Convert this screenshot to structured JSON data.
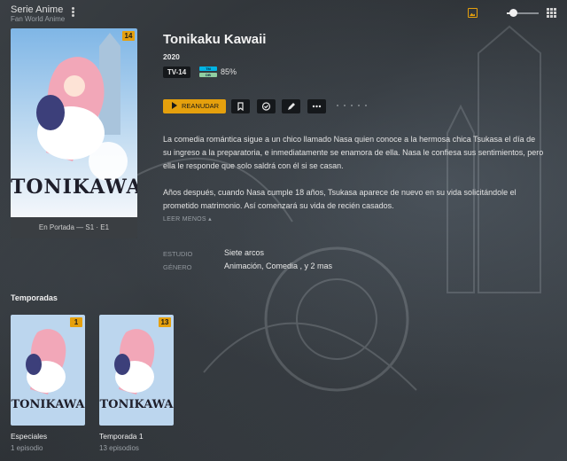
{
  "header": {
    "title": "Serie Anime",
    "subtitle": "Fan World Anime"
  },
  "colors": {
    "accent": "#e5a00d",
    "background": "#2f3336"
  },
  "icons": {
    "menu": "kebab-icon",
    "backdrop_toggle": "image-icon",
    "view_grid": "grid-icon"
  },
  "zoom_slider": {
    "level": 0.2
  },
  "show": {
    "poster_badge": "14",
    "poster_logo": "TONIKAWA",
    "on_deck_caption": "En Portada — S1 · E1",
    "title": "Tonikaku Kawaii",
    "year": "2020",
    "content_rating": "TV-14",
    "tmdb_top": "TM",
    "tmdb_bottom": "DB",
    "score": "85%",
    "play_label": "REANUDAR",
    "summary_1": "La comedia romántica sigue a un chico llamado Nasa quien conoce a la hermosa chica Tsukasa el día de su ingreso a la preparatoria, e inmediatamente se enamora de ella. Nasa le confiesa sus sentimientos, pero ella le responde que solo saldrá con él si se casan.",
    "summary_2": "Años después, cuando Nasa cumple 18 años, Tsukasa aparece de nuevo en su vida solicitándole el prometido matrimonio. Así comenzará su vida de recién casados.",
    "read_less": "LEER MENOS ▴",
    "studio_label": "ESTUDIO",
    "studio_value": "Siete arcos",
    "genre_label": "GÉNERO",
    "genre_value": "Animación, Comedia , y 2 mas"
  },
  "seasons": {
    "heading": "Temporadas",
    "items": [
      {
        "title": "Especiales",
        "subtitle": "1 episodio",
        "badge": "1",
        "logo": "TONIKAWA"
      },
      {
        "title": "Temporada 1",
        "subtitle": "13 episodios",
        "badge": "13",
        "logo": "TONIKAWA"
      }
    ]
  }
}
